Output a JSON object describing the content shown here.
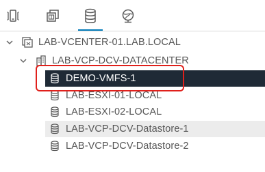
{
  "tabs": [
    {
      "name": "hosts-and-clusters",
      "icon": "hosts-clusters-icon",
      "active": false
    },
    {
      "name": "vms-and-templates",
      "icon": "vms-templates-icon",
      "active": false
    },
    {
      "name": "storage",
      "icon": "database-icon",
      "active": true
    },
    {
      "name": "networking",
      "icon": "network-globe-icon",
      "active": false
    }
  ],
  "colors": {
    "accent": "#0079b8",
    "selected_bg": "#1f2a36",
    "hover_bg": "#ececec",
    "callout": "#e0201b"
  },
  "tree": {
    "vcenter": {
      "label": "LAB-VCENTER-01.LAB.LOCAL",
      "expanded": true
    },
    "datacenter": {
      "label": "LAB-VCP-DCV-DATACENTER",
      "expanded": true
    },
    "datastores": [
      {
        "label": "DEMO-VMFS-1",
        "state": "selected"
      },
      {
        "label": "LAB-ESXI-01-LOCAL",
        "state": "normal"
      },
      {
        "label": "LAB-ESXI-02-LOCAL",
        "state": "normal"
      },
      {
        "label": "LAB-VCP-DCV-Datastore-1",
        "state": "hover"
      },
      {
        "label": "LAB-VCP-DCV-Datastore-2",
        "state": "normal"
      }
    ]
  }
}
